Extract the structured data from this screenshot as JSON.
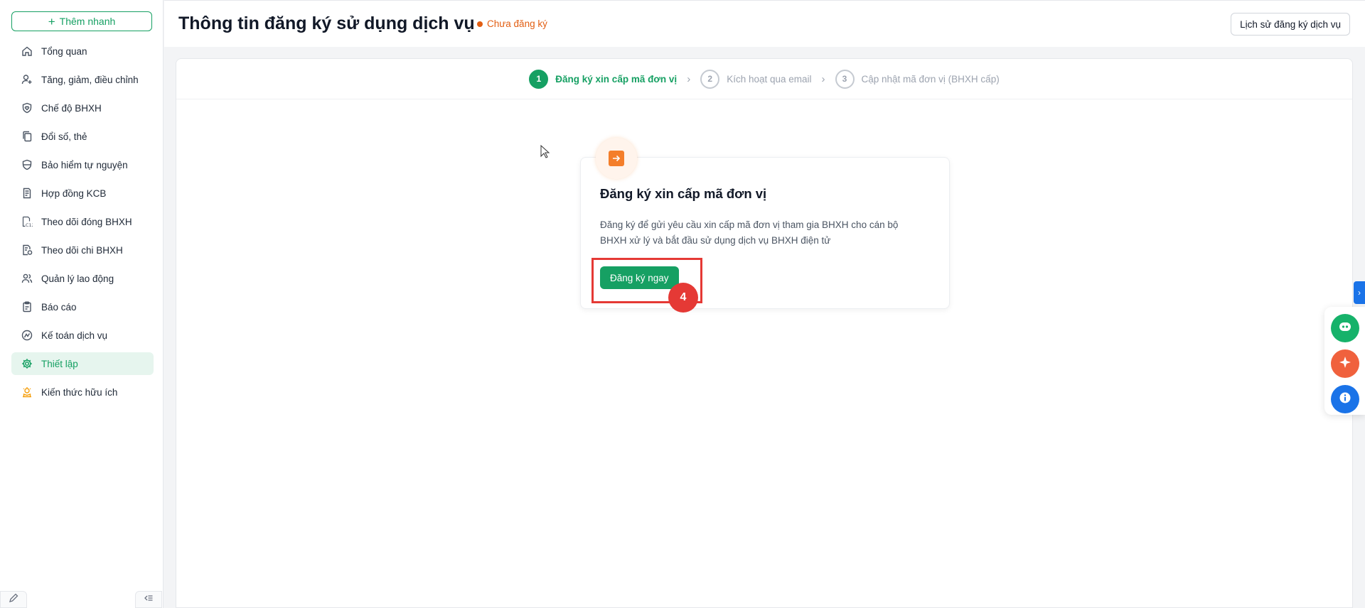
{
  "sidebar": {
    "quick_add_label": "Thêm nhanh",
    "items": [
      {
        "label": "Tổng quan",
        "icon": "home-icon"
      },
      {
        "label": "Tăng, giảm, điều chỉnh",
        "icon": "user-plus-icon"
      },
      {
        "label": "Chế độ BHXH",
        "icon": "shield-heart-icon"
      },
      {
        "label": "Đổi số, thẻ",
        "icon": "copy-icon"
      },
      {
        "label": "Bảo hiểm tự nguyện",
        "icon": "shield-icon"
      },
      {
        "label": "Hợp đồng KCB",
        "icon": "contract-icon"
      },
      {
        "label": "Theo dõi đóng BHXH",
        "icon": "c12-icon"
      },
      {
        "label": "Theo dõi chi BHXH",
        "icon": "document-money-icon"
      },
      {
        "label": "Quản lý lao động",
        "icon": "users-icon"
      },
      {
        "label": "Báo cáo",
        "icon": "clipboard-icon"
      },
      {
        "label": "Kế toán dịch vụ",
        "icon": "accounting-icon"
      },
      {
        "label": "Thiết lập",
        "icon": "gear-icon",
        "active": true
      },
      {
        "label": "Kiến thức hữu ích",
        "icon": "knowledge-icon"
      }
    ]
  },
  "header": {
    "title": "Thông tin đăng ký sử dụng dịch vụ",
    "status": "Chưa đăng ký",
    "history_button": "Lịch sử đăng ký dịch vụ"
  },
  "steps": [
    {
      "num": "1",
      "label": "Đăng ký xin cấp mã đơn vị",
      "active": true
    },
    {
      "num": "2",
      "label": "Kích hoạt qua email",
      "active": false
    },
    {
      "num": "3",
      "label": "Cập nhật mã đơn vị (BHXH cấp)",
      "active": false
    }
  ],
  "card": {
    "title": "Đăng ký xin cấp mã đơn vị",
    "description": "Đăng ký để gửi yêu cầu xin cấp mã đơn vị tham gia BHXH cho cán bộ BHXH xử lý và bắt đầu sử dụng dịch vụ BHXH điện tử",
    "button": "Đăng ký ngay"
  },
  "annotation": {
    "badge": "4"
  },
  "colors": {
    "primary": "#16a063",
    "warning": "#e25e12",
    "highlight": "#e53935",
    "blue": "#1a73e8"
  }
}
